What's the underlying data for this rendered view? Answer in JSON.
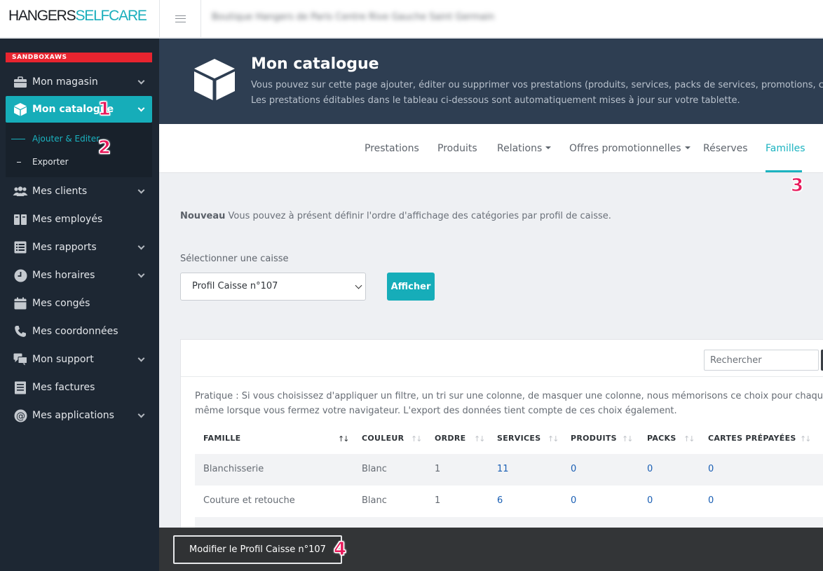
{
  "brand": {
    "part1": "HANGERS",
    "part2": "SELFCARE"
  },
  "topbar": {
    "blurred_text": "Boutique Hangers de Paris Centre Rive Gauche Saint Germain"
  },
  "sidebar": {
    "env_badge": "SANDBOXAWS",
    "items": [
      {
        "label": "Mon magasin",
        "icon": "briefcase-icon",
        "has_chevron": true
      },
      {
        "label": "Mon catalogue",
        "icon": "box-icon",
        "has_chevron": true,
        "active": true
      },
      {
        "label": "Mes clients",
        "icon": "users-icon",
        "has_chevron": true
      },
      {
        "label": "Mes employés",
        "icon": "id-card-icon",
        "has_chevron": false
      },
      {
        "label": "Mes rapports",
        "icon": "list-icon",
        "has_chevron": true
      },
      {
        "label": "Mes horaires",
        "icon": "clock-icon",
        "has_chevron": true
      },
      {
        "label": "Mes congés",
        "icon": "calendar-icon",
        "has_chevron": false
      },
      {
        "label": "Mes coordonnées",
        "icon": "phone-icon",
        "has_chevron": false
      },
      {
        "label": "Mon support",
        "icon": "chat-icon",
        "has_chevron": true
      },
      {
        "label": "Mes factures",
        "icon": "invoice-icon",
        "has_chevron": false
      },
      {
        "label": "Mes applications",
        "icon": "at-icon",
        "has_chevron": true
      }
    ],
    "submenu": [
      {
        "label": "Ajouter & Editer",
        "active": true
      },
      {
        "label": "Exporter",
        "active": false
      }
    ]
  },
  "annotations": [
    "1",
    "2",
    "3",
    "4"
  ],
  "hero": {
    "title": "Mon catalogue",
    "desc_line1": "Vous pouvez sur cette page ajouter, éditer ou supprimer vos prestations (produits, services, packs de services, promotions, carte",
    "desc_line2": "Les prestations éditables dans le tableau ci-dessous sont automatiquement mises à jour sur votre tablette."
  },
  "tabs": [
    {
      "label": "Prestations",
      "dropdown": false
    },
    {
      "label": "Produits",
      "dropdown": false
    },
    {
      "label": "Relations",
      "dropdown": true
    },
    {
      "label": "Offres promotionnelles",
      "dropdown": true
    },
    {
      "label": "Réserves",
      "dropdown": false
    },
    {
      "label": "Familles",
      "dropdown": false,
      "active": true
    }
  ],
  "notice": {
    "strong": "Nouveau",
    "text": " Vous pouvez à présent définir l'ordre d'affichage des catégories par profil de caisse."
  },
  "caisse": {
    "label": "Sélectionner une caisse",
    "selected": "Profil Caisse n°107",
    "button": "Afficher"
  },
  "table": {
    "search_placeholder": "Rechercher",
    "tip_line1": "Pratique : Si vous choisissez d'appliquer un filtre, un tri sur une colonne, de masquer une colonne, nous mémorisons ce choix pour chaque pr",
    "tip_line2": "même lorsque vous fermez votre navigateur. L'export des données tient compte de ces choix également.",
    "columns": [
      "FAMILLE",
      "COULEUR",
      "ORDRE",
      "SERVICES",
      "PRODUITS",
      "PACKS",
      "CARTES PRÉPAYÉES"
    ],
    "sorted_column": "FAMILLE",
    "rows": [
      {
        "famille": "Blanchisserie",
        "couleur": "Blanc",
        "ordre": "1",
        "services": "11",
        "produits": "0",
        "packs": "0",
        "cartes": "0"
      },
      {
        "famille": "Couture et retouche",
        "couleur": "Blanc",
        "ordre": "1",
        "services": "6",
        "produits": "0",
        "packs": "0",
        "cartes": "0"
      }
    ]
  },
  "footer": {
    "button": "Modifier le Profil Caisse n°107"
  },
  "colors": {
    "accent": "#16adb9",
    "sidebar_bg": "#1d2733",
    "hero_bg": "#2e3e52",
    "annotation": "#e8195b",
    "badge": "#e8242f"
  }
}
